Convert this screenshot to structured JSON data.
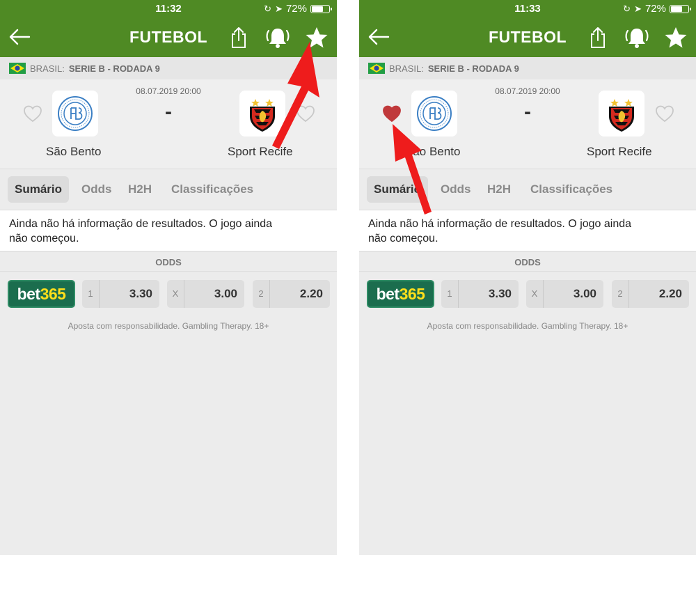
{
  "colors": {
    "header": "#4f8a24",
    "favorite_active": "#c0393b",
    "favorite_inactive": "#c8c8c8",
    "bet365_bg": "#1b6d4e",
    "bet365_accent": "#ffdf1b",
    "annotation_arrow": "#ee1c1c"
  },
  "screens": [
    {
      "status": {
        "time": "11:32",
        "battery": "72%",
        "battery_level": 0.72
      },
      "nav": {
        "title": "FUTEBOL",
        "back_icon": "arrow-left-icon",
        "share_icon": "share-icon",
        "alert_icon": "bell-icon",
        "favorite_icon": "star-icon"
      },
      "league": {
        "country": "BRASIL:",
        "competition": "SERIE B - RODADA 9"
      },
      "match": {
        "date": "08.07.2019 20:00",
        "score": "-",
        "home": {
          "name": "São Bento",
          "favorited": false
        },
        "away": {
          "name": "Sport Recife",
          "favorited": false
        }
      },
      "tabs": [
        {
          "label": "Sumário",
          "active": true
        },
        {
          "label": "Odds",
          "active": false
        },
        {
          "label": "H2H",
          "active": false
        },
        {
          "label": "Classificações",
          "active": false
        }
      ],
      "info": {
        "line1": "Ainda não há informação de resultados. O jogo ainda",
        "line2": "não começou."
      },
      "odds": {
        "header": "ODDS",
        "bookmaker_part1": "bet",
        "bookmaker_part2": "365",
        "items": [
          {
            "label": "1",
            "value": "3.30"
          },
          {
            "label": "X",
            "value": "3.00"
          },
          {
            "label": "2",
            "value": "2.20"
          }
        ]
      },
      "disclaimer": "Aposta com responsabilidade. Gambling Therapy. 18+"
    },
    {
      "status": {
        "time": "11:33",
        "battery": "72%",
        "battery_level": 0.72
      },
      "nav": {
        "title": "FUTEBOL",
        "back_icon": "arrow-left-icon",
        "share_icon": "share-icon",
        "alert_icon": "bell-icon",
        "favorite_icon": "star-icon"
      },
      "league": {
        "country": "BRASIL:",
        "competition": "SERIE B - RODADA 9"
      },
      "match": {
        "date": "08.07.2019 20:00",
        "score": "-",
        "home": {
          "name": "São Bento",
          "favorited": true
        },
        "away": {
          "name": "Sport Recife",
          "favorited": false
        }
      },
      "tabs": [
        {
          "label": "Sumário",
          "active": true
        },
        {
          "label": "Odds",
          "active": false
        },
        {
          "label": "H2H",
          "active": false
        },
        {
          "label": "Classificações",
          "active": false
        }
      ],
      "info": {
        "line1": "Ainda não há informação de resultados. O jogo ainda",
        "line2": "não começou."
      },
      "odds": {
        "header": "ODDS",
        "bookmaker_part1": "bet",
        "bookmaker_part2": "365",
        "items": [
          {
            "label": "1",
            "value": "3.30"
          },
          {
            "label": "X",
            "value": "3.00"
          },
          {
            "label": "2",
            "value": "2.20"
          }
        ]
      },
      "disclaimer": "Aposta com responsabilidade. Gambling Therapy. 18+"
    }
  ]
}
